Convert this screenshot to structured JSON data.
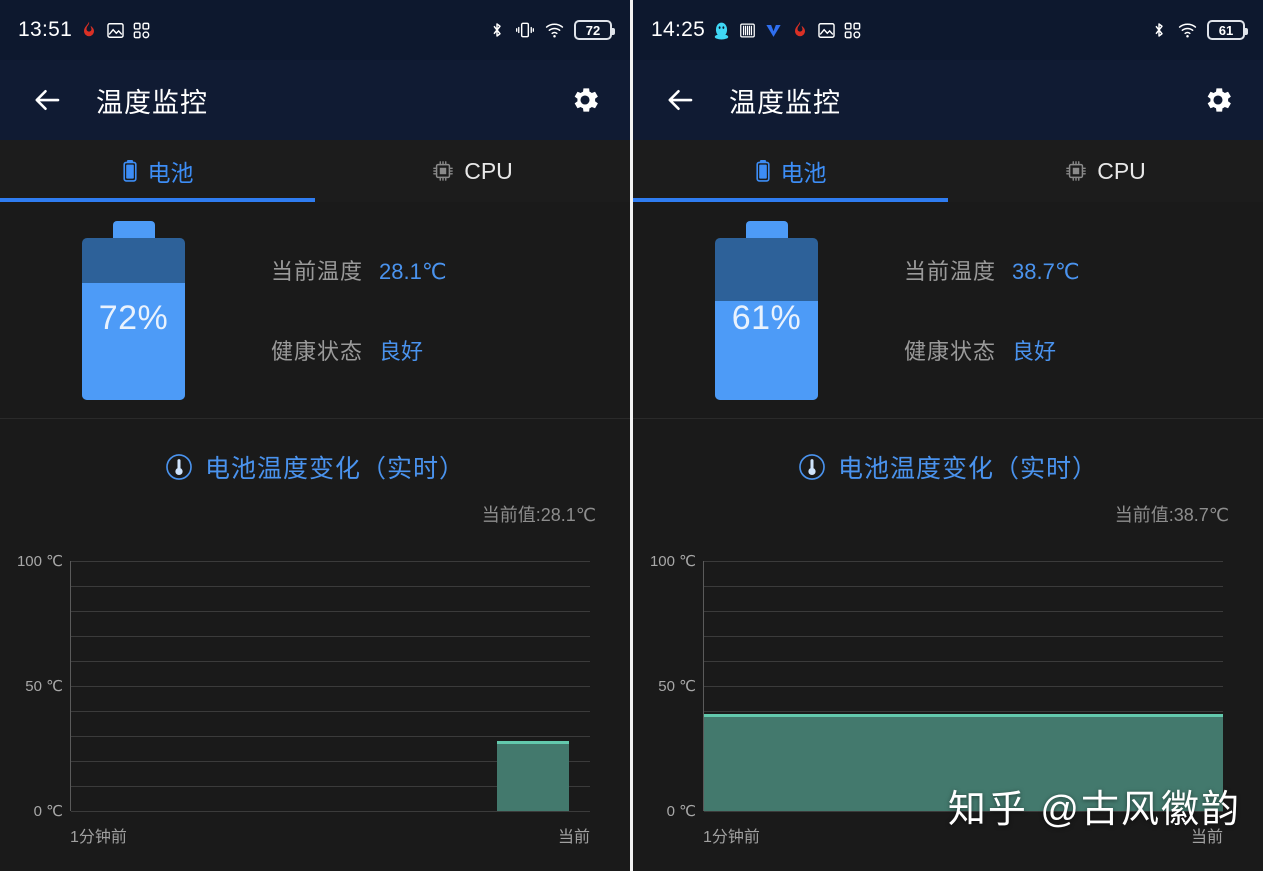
{
  "panels": [
    {
      "statusbar": {
        "time": "13:51",
        "left_icons": [
          "flame-icon",
          "image-icon",
          "grid-icon"
        ],
        "right_icons": [
          "bluetooth-icon",
          "vibrate-icon",
          "wifi-icon"
        ],
        "battery_level": "72"
      },
      "appbar": {
        "back": "back-arrow-icon",
        "title": "温度监控",
        "settings": "gear-icon"
      },
      "tabs": [
        {
          "label": "电池",
          "icon": "battery-icon",
          "active": true
        },
        {
          "label": "CPU",
          "icon": "cpu-chip-icon",
          "active": false
        }
      ],
      "battery_card": {
        "percent_label": "72%",
        "percent_value": 72,
        "temp_label": "当前温度",
        "temp_value": "28.1℃",
        "health_label": "健康状态",
        "health_value": "良好"
      },
      "chart_card": {
        "icon": "thermometer-icon",
        "title": "电池温度变化（实时）",
        "current_label": "当前值:28.1℃"
      },
      "chart_data": {
        "type": "bar",
        "title": "电池温度变化（实时）",
        "xlabel": "",
        "ylabel": "℃",
        "ylim": [
          0,
          100
        ],
        "yticks": [
          0,
          50,
          100
        ],
        "ytick_labels": [
          "0 ℃",
          "50 ℃",
          "100 ℃"
        ],
        "grid": true,
        "gridline_step": 10,
        "x_tick_labels": [
          "1分钟前",
          "当前"
        ],
        "categories": [
          "1分钟前",
          "当前"
        ],
        "values": [
          null,
          28.1
        ],
        "series": [
          {
            "name": "电池温度",
            "values": [
              28.1
            ],
            "color": "#43796d",
            "edge_color": "#63c9ad"
          }
        ],
        "bar_left_pct": 82,
        "bar_width_pct": 14
      },
      "watermark": ""
    },
    {
      "statusbar": {
        "time": "14:25",
        "left_icons": [
          "qq-penguin-icon",
          "barcode-icon",
          "v-logo-icon",
          "flame-icon",
          "image-icon",
          "grid-icon"
        ],
        "right_icons": [
          "bluetooth-icon",
          "wifi-icon"
        ],
        "battery_level": "61"
      },
      "appbar": {
        "back": "back-arrow-icon",
        "title": "温度监控",
        "settings": "gear-icon"
      },
      "tabs": [
        {
          "label": "电池",
          "icon": "battery-icon",
          "active": true
        },
        {
          "label": "CPU",
          "icon": "cpu-chip-icon",
          "active": false
        }
      ],
      "battery_card": {
        "percent_label": "61%",
        "percent_value": 61,
        "temp_label": "当前温度",
        "temp_value": "38.7℃",
        "health_label": "健康状态",
        "health_value": "良好"
      },
      "chart_card": {
        "icon": "thermometer-icon",
        "title": "电池温度变化（实时）",
        "current_label": "当前值:38.7℃"
      },
      "chart_data": {
        "type": "bar",
        "title": "电池温度变化（实时）",
        "xlabel": "",
        "ylabel": "℃",
        "ylim": [
          0,
          100
        ],
        "yticks": [
          0,
          50,
          100
        ],
        "ytick_labels": [
          "0 ℃",
          "50 ℃",
          "100 ℃"
        ],
        "grid": true,
        "gridline_step": 10,
        "x_tick_labels": [
          "1分钟前",
          "当前"
        ],
        "categories": [
          "1分钟前",
          "当前"
        ],
        "values": [
          38.7,
          38.7
        ],
        "series": [
          {
            "name": "电池温度",
            "values": [
              38.7
            ],
            "color": "#43796d",
            "edge_color": "#63c9ad"
          }
        ],
        "bar_left_pct": 0,
        "bar_width_pct": 100
      },
      "watermark": "知乎 @古风徽韵"
    }
  ],
  "colors": {
    "accent_blue": "#4a93ee",
    "tab_underline": "#2f7cf0",
    "battery_fill": "#4d9bf7",
    "battery_empty": "#2d6199",
    "chart_bar": "#43796d",
    "chart_bar_edge": "#63c9ad",
    "statusbar_bg": "#0d182e",
    "appbar_bg": "#101b33",
    "card_bg": "#1a1a1a"
  }
}
